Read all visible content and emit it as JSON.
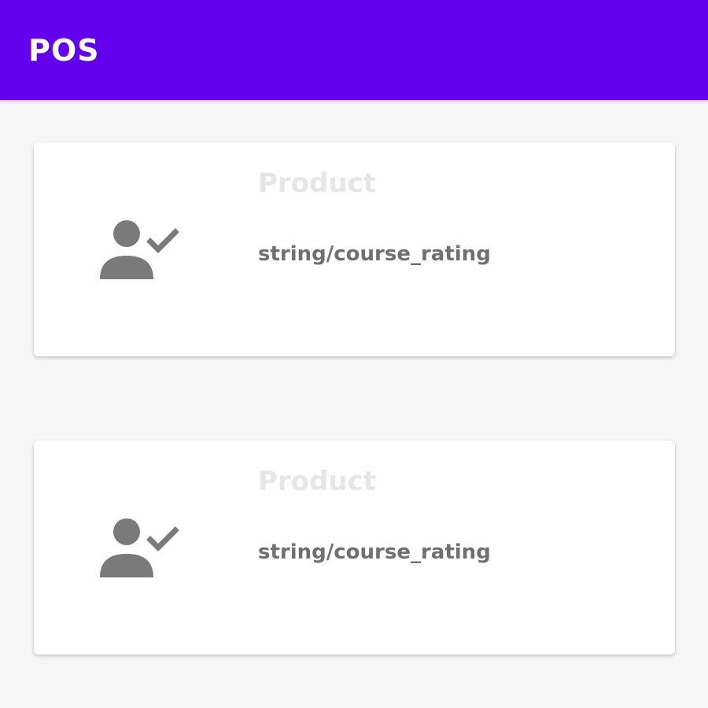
{
  "appbar": {
    "title": "POS",
    "color": "#6200ee"
  },
  "cards": [
    {
      "icon": "person-check-icon",
      "heading": "Product",
      "text": "string/course_rating"
    },
    {
      "icon": "person-check-icon",
      "heading": "Product",
      "text": "string/course_rating"
    }
  ]
}
